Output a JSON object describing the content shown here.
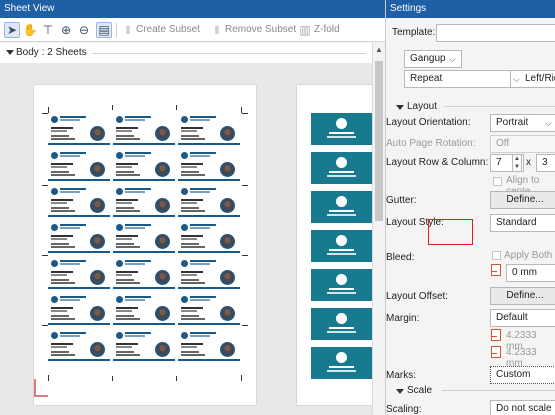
{
  "sheet_view": {
    "title": "Sheet View",
    "toolbar": {
      "create_subset": "Create Subset",
      "remove_subset": "Remove Subset",
      "z_fold": "Z-fold"
    },
    "body_label": "Body : 2 Sheets"
  },
  "settings": {
    "title": "Settings",
    "template_label": "Template:",
    "gangup": "Gangup",
    "repeat": "Repeat",
    "left_right": "Left/Rig",
    "layout_section": "Layout",
    "layout_orientation_label": "Layout Orientation:",
    "layout_orientation_value": "Portrait",
    "auto_rotation_label": "Auto Page Rotation:",
    "auto_rotation_value": "Off",
    "row_column_label": "Layout Row & Column:",
    "rows": "7",
    "times": "x",
    "columns": "3",
    "align_center": "Align to cente",
    "gutter_label": "Gutter:",
    "gutter_button": "Define...",
    "layout_style_label": "Layout Style:",
    "layout_style_value": "Standard",
    "bleed_label": "Bleed:",
    "apply_both": "Apply Both",
    "bleed_value": "0 mm",
    "layout_offset_label": "Layout Offset:",
    "layout_offset_button": "Define...",
    "margin_label": "Margin:",
    "margin_value": "Default",
    "margin_1": "4.2333 mm",
    "margin_2": "4.2333 mm",
    "marks_label": "Marks:",
    "marks_value": "Custom",
    "scale_section": "Scale",
    "scaling_label": "Scaling:",
    "scaling_value": "Do not scale"
  }
}
